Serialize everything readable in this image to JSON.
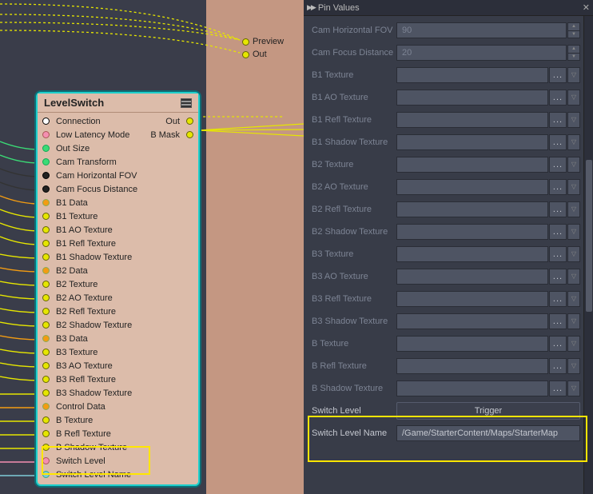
{
  "panel": {
    "title": "Pin Values"
  },
  "ext_pins": [
    {
      "label": "Preview",
      "y": 46
    },
    {
      "label": "Out",
      "y": 62
    }
  ],
  "node": {
    "title": "LevelSwitch",
    "outputs": [
      {
        "label": "Out"
      },
      {
        "label": "B Mask"
      }
    ]
  },
  "node_pins": [
    {
      "label": "Connection",
      "color": "white",
      "out": "Out"
    },
    {
      "label": "Low Latency Mode",
      "color": "pink",
      "out": "B Mask"
    },
    {
      "label": "Out Size",
      "color": "green"
    },
    {
      "label": "Cam Transform",
      "color": "green"
    },
    {
      "label": "Cam Horizontal FOV",
      "color": "black"
    },
    {
      "label": "Cam Focus Distance",
      "color": "black"
    },
    {
      "label": "B1 Data",
      "color": "orange"
    },
    {
      "label": "B1 Texture",
      "color": "yellow"
    },
    {
      "label": "B1 AO Texture",
      "color": "yellow"
    },
    {
      "label": "B1 Refl Texture",
      "color": "yellow"
    },
    {
      "label": "B1 Shadow Texture",
      "color": "yellow"
    },
    {
      "label": "B2 Data",
      "color": "orange"
    },
    {
      "label": "B2 Texture",
      "color": "yellow"
    },
    {
      "label": "B2 AO Texture",
      "color": "yellow"
    },
    {
      "label": "B2 Refl Texture",
      "color": "yellow"
    },
    {
      "label": "B2 Shadow Texture",
      "color": "yellow"
    },
    {
      "label": "B3 Data",
      "color": "orange"
    },
    {
      "label": "B3 Texture",
      "color": "yellow"
    },
    {
      "label": "B3 AO Texture",
      "color": "yellow"
    },
    {
      "label": "B3 Refl Texture",
      "color": "yellow"
    },
    {
      "label": "B3 Shadow Texture",
      "color": "yellow"
    },
    {
      "label": "Control Data",
      "color": "orange"
    },
    {
      "label": "B Texture",
      "color": "yellow"
    },
    {
      "label": "B Refl Texture",
      "color": "yellow"
    },
    {
      "label": "B Shadow Texture",
      "color": "yellow"
    },
    {
      "label": "Switch Level",
      "color": "pink"
    },
    {
      "label": "Switch Level Name",
      "color": "blue"
    }
  ],
  "props": [
    {
      "label": "Cam Horizontal FOV",
      "type": "number",
      "value": "90",
      "dim": true
    },
    {
      "label": "Cam Focus Distance",
      "type": "number",
      "value": "20",
      "dim": true
    },
    {
      "label": "B1 Texture",
      "type": "picker",
      "value": "",
      "dim": true
    },
    {
      "label": "B1 AO Texture",
      "type": "picker",
      "value": "",
      "dim": true
    },
    {
      "label": "B1 Refl Texture",
      "type": "picker",
      "value": "",
      "dim": true
    },
    {
      "label": "B1 Shadow Texture",
      "type": "picker",
      "value": "",
      "dim": true
    },
    {
      "label": "B2 Texture",
      "type": "picker",
      "value": "",
      "dim": true
    },
    {
      "label": "B2 AO Texture",
      "type": "picker",
      "value": "",
      "dim": true
    },
    {
      "label": "B2 Refl Texture",
      "type": "picker",
      "value": "",
      "dim": true
    },
    {
      "label": "B2 Shadow Texture",
      "type": "picker",
      "value": "",
      "dim": true
    },
    {
      "label": "B3 Texture",
      "type": "picker",
      "value": "",
      "dim": true
    },
    {
      "label": "B3 AO Texture",
      "type": "picker",
      "value": "",
      "dim": true
    },
    {
      "label": "B3 Refl Texture",
      "type": "picker",
      "value": "",
      "dim": true
    },
    {
      "label": "B3 Shadow Texture",
      "type": "picker",
      "value": "",
      "dim": true
    },
    {
      "label": "B Texture",
      "type": "picker",
      "value": "",
      "dim": true
    },
    {
      "label": "B Refl Texture",
      "type": "picker",
      "value": "",
      "dim": true
    },
    {
      "label": "B Shadow Texture",
      "type": "picker",
      "value": "",
      "dim": true
    },
    {
      "label": "Switch Level",
      "type": "trigger",
      "value": "Trigger",
      "dim": false
    },
    {
      "label": "Switch Level Name",
      "type": "text",
      "value": "/Game/StarterContent/Maps/StarterMap",
      "dim": false
    }
  ]
}
